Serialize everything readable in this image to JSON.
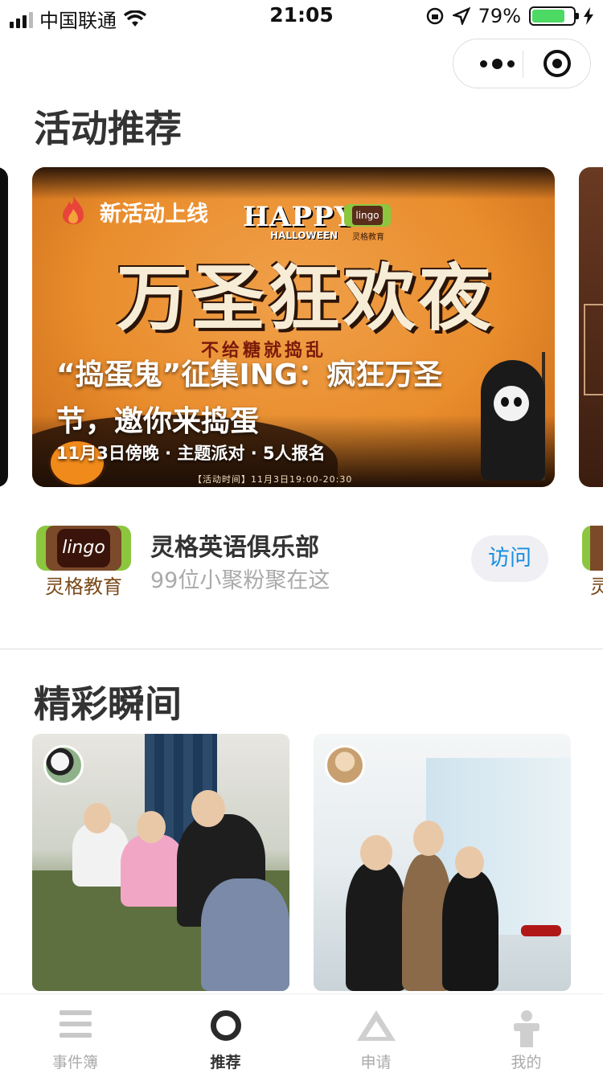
{
  "status_bar": {
    "carrier": "中国联通",
    "time": "21:05",
    "battery": "79%",
    "battery_level": 0.79,
    "icons": [
      "signal-icon",
      "wifi-icon",
      "rotation-lock-icon",
      "location-icon",
      "battery-icon",
      "charging-icon"
    ]
  },
  "capsule": {
    "icons": [
      "more-dots-icon",
      "close-target-icon"
    ]
  },
  "sections": {
    "activities_title": "活动推荐",
    "moments_title": "精彩瞬间"
  },
  "featured_card": {
    "badge": "新活动上线",
    "poster_happy": "HAPPY",
    "poster_halloween": "HALLOWEEN",
    "poster_brand": "lingo",
    "poster_brand_sub": "灵格教育",
    "poster_title": "万圣狂欢夜",
    "poster_trick": "不给糖就捣乱",
    "title": "“捣蛋鬼”征集ING：疯狂万圣节，邀你来捣蛋",
    "meta": "11月3日傍晚 · 主题派对 · 5人报名",
    "poster_time": "【活动时间】11月3日19:00-20:30"
  },
  "club": {
    "logo_text": "lingo",
    "logo_caption": "灵格教育",
    "name": "灵格英语俱乐部",
    "subtitle": "99位小聚粉聚在这",
    "visit_label": "访问",
    "peek_caption": "灵"
  },
  "moments": [
    {
      "avatar": "panda-avatar"
    },
    {
      "avatar": "girl-avatar"
    }
  ],
  "tabbar": {
    "items": [
      {
        "label": "事件簿",
        "icon": "list-icon",
        "active": false
      },
      {
        "label": "推荐",
        "icon": "circle-icon",
        "active": true
      },
      {
        "label": "申请",
        "icon": "triangle-icon",
        "active": false
      },
      {
        "label": "我的",
        "icon": "person-icon",
        "active": false
      }
    ],
    "active_color": "#333333",
    "inactive_color": "#aaaaaa"
  },
  "colors": {
    "accent": "#1a8fe0",
    "poster_orange": "#e98d2d",
    "brand_green": "#8cc63f"
  }
}
